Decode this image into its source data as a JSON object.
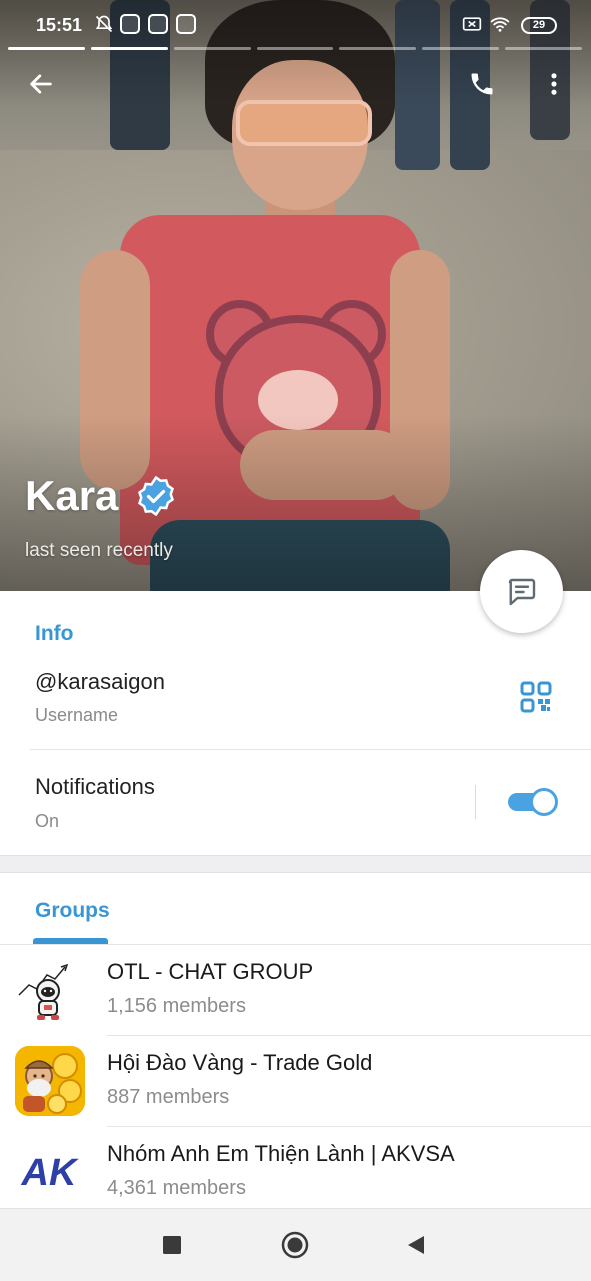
{
  "status_bar": {
    "time": "15:51",
    "battery": "29"
  },
  "profile": {
    "name": "Kara",
    "last_seen": "last seen recently"
  },
  "info": {
    "section_title": "Info",
    "username_value": "@karasaigon",
    "username_label": "Username",
    "notifications_label": "Notifications",
    "notifications_state": "On"
  },
  "groups": {
    "section_title": "Groups",
    "items": [
      {
        "name": "OTL - CHAT GROUP",
        "members": "1,156 members"
      },
      {
        "name": "Hội Đào Vàng - Trade Gold",
        "members": "887 members"
      },
      {
        "name": "Nhóm Anh Em Thiện Lành | AKVSA",
        "members": "4,361 members",
        "avatar_text": "AK"
      }
    ]
  },
  "colors": {
    "accent": "#3a96d3",
    "toggle": "#4aa3e0"
  },
  "icons": [
    "back-arrow-icon",
    "phone-icon",
    "more-vert-icon",
    "verified-badge-icon",
    "message-icon",
    "qr-code-icon",
    "nav-square-icon",
    "nav-circle-icon",
    "nav-back-icon"
  ]
}
